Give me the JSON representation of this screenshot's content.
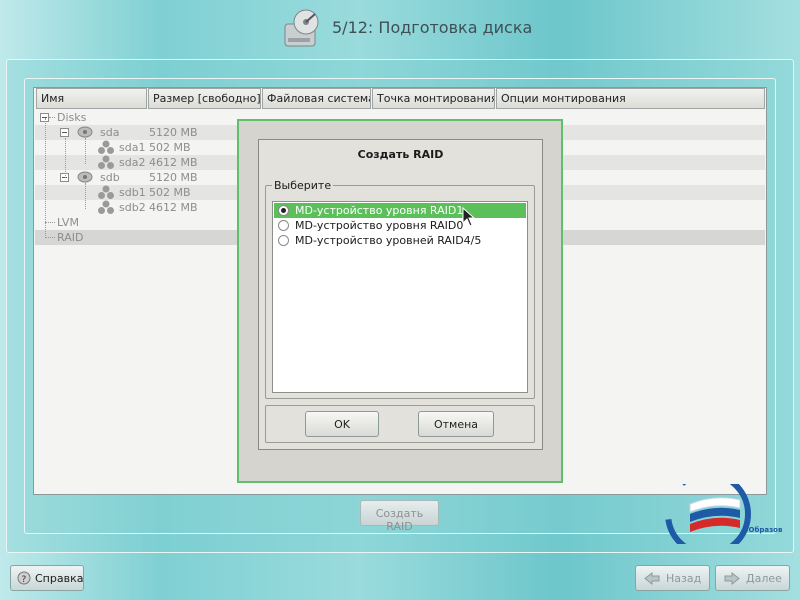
{
  "header": {
    "title": "5/12: Подготовка диска",
    "icon": "disk-drive-icon"
  },
  "table": {
    "columns": [
      "Имя",
      "Размер [свободно]",
      "Файловая система",
      "Точка монтирования",
      "Опции монтирования"
    ],
    "rows": [
      {
        "name": "Disks",
        "size": ""
      },
      {
        "name": "sda",
        "size": "5120 MB"
      },
      {
        "name": "sda1",
        "size": "502 MB"
      },
      {
        "name": "sda2",
        "size": "4612 MB"
      },
      {
        "name": "sdb",
        "size": "5120 MB"
      },
      {
        "name": "sdb1",
        "size": "502 MB"
      },
      {
        "name": "sdb2",
        "size": "4612 MB"
      },
      {
        "name": "LVM",
        "size": ""
      },
      {
        "name": "RAID",
        "size": ""
      }
    ]
  },
  "bottom": {
    "create_raid_label": "Создать RAID"
  },
  "dialog": {
    "title": "Создать RAID",
    "group_label": "Выберите",
    "options": [
      {
        "label": "MD-устройство уровня RAID1",
        "selected": true
      },
      {
        "label": "MD-устройство уровня RAID0",
        "selected": false
      },
      {
        "label": "MD-устройство уровней RAID4/5",
        "selected": false
      }
    ],
    "ok_label": "OK",
    "cancel_label": "Отмена"
  },
  "footer": {
    "help_label": "Справка",
    "back_label": "Назад",
    "next_label": "Далее"
  },
  "logo": {
    "text": "«Образование»"
  },
  "colors": {
    "accent": "#5bbf5a",
    "background": "#7fd0d3"
  }
}
